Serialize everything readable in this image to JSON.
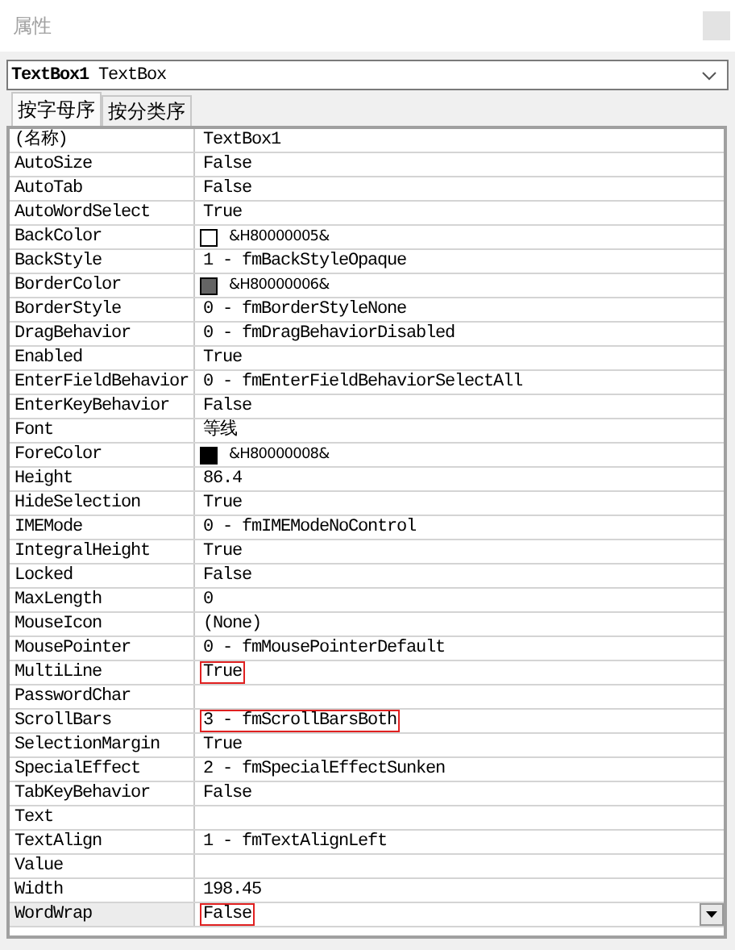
{
  "window": {
    "title": "属性"
  },
  "object_selector": {
    "name": "TextBox1",
    "type": "TextBox"
  },
  "tabs": [
    {
      "label": "按字母序",
      "selected": true
    },
    {
      "label": "按分类序",
      "selected": false
    }
  ],
  "properties": [
    {
      "name": "(名称)",
      "value": "TextBox1",
      "selected": false,
      "highlighted": false
    },
    {
      "name": "AutoSize",
      "value": "False",
      "selected": false,
      "highlighted": false
    },
    {
      "name": "AutoTab",
      "value": "False",
      "selected": false,
      "highlighted": false
    },
    {
      "name": "AutoWordSelect",
      "value": "True",
      "selected": false,
      "highlighted": false
    },
    {
      "name": "BackColor",
      "value": "&H80000005&",
      "color": "#ffffff",
      "selected": false,
      "highlighted": false
    },
    {
      "name": "BackStyle",
      "value": "1 - fmBackStyleOpaque",
      "selected": false,
      "highlighted": false
    },
    {
      "name": "BorderColor",
      "value": "&H80000006&",
      "color": "#646464",
      "selected": false,
      "highlighted": false
    },
    {
      "name": "BorderStyle",
      "value": "0 - fmBorderStyleNone",
      "selected": false,
      "highlighted": false
    },
    {
      "name": "DragBehavior",
      "value": "0 - fmDragBehaviorDisabled",
      "selected": false,
      "highlighted": false
    },
    {
      "name": "Enabled",
      "value": "True",
      "selected": false,
      "highlighted": false
    },
    {
      "name": "EnterFieldBehavior",
      "value": "0 - fmEnterFieldBehaviorSelectAll",
      "selected": false,
      "highlighted": false
    },
    {
      "name": "EnterKeyBehavior",
      "value": "False",
      "selected": false,
      "highlighted": false
    },
    {
      "name": "Font",
      "value": "等线",
      "selected": false,
      "highlighted": false
    },
    {
      "name": "ForeColor",
      "value": "&H80000008&",
      "color": "#000000",
      "selected": false,
      "highlighted": false
    },
    {
      "name": "Height",
      "value": "86.4",
      "selected": false,
      "highlighted": false
    },
    {
      "name": "HideSelection",
      "value": "True",
      "selected": false,
      "highlighted": false
    },
    {
      "name": "IMEMode",
      "value": "0 - fmIMEModeNoControl",
      "selected": false,
      "highlighted": false
    },
    {
      "name": "IntegralHeight",
      "value": "True",
      "selected": false,
      "highlighted": false
    },
    {
      "name": "Locked",
      "value": "False",
      "selected": false,
      "highlighted": false
    },
    {
      "name": "MaxLength",
      "value": "0",
      "selected": false,
      "highlighted": false
    },
    {
      "name": "MouseIcon",
      "value": "(None)",
      "selected": false,
      "highlighted": false
    },
    {
      "name": "MousePointer",
      "value": "0 - fmMousePointerDefault",
      "selected": false,
      "highlighted": false
    },
    {
      "name": "MultiLine",
      "value": "True",
      "selected": false,
      "highlighted": true
    },
    {
      "name": "PasswordChar",
      "selected": false
    },
    {
      "name": "ScrollBars",
      "value": "3 - fmScrollBarsBoth",
      "selected": false,
      "highlighted": true
    },
    {
      "name": "SelectionMargin",
      "value": "True",
      "selected": false,
      "highlighted": false
    },
    {
      "name": "SpecialEffect",
      "value": "2 - fmSpecialEffectSunken",
      "selected": false,
      "highlighted": false
    },
    {
      "name": "TabKeyBehavior",
      "value": "False",
      "selected": false,
      "highlighted": false
    },
    {
      "name": "Text",
      "selected": false
    },
    {
      "name": "TextAlign",
      "value": "1 - fmTextAlignLeft",
      "selected": false,
      "highlighted": false
    },
    {
      "name": "Value",
      "selected": false
    },
    {
      "name": "Width",
      "value": "198.45",
      "selected": false,
      "highlighted": false
    },
    {
      "name": "WordWrap",
      "value": "False",
      "selected": true,
      "highlighted": true
    }
  ]
}
